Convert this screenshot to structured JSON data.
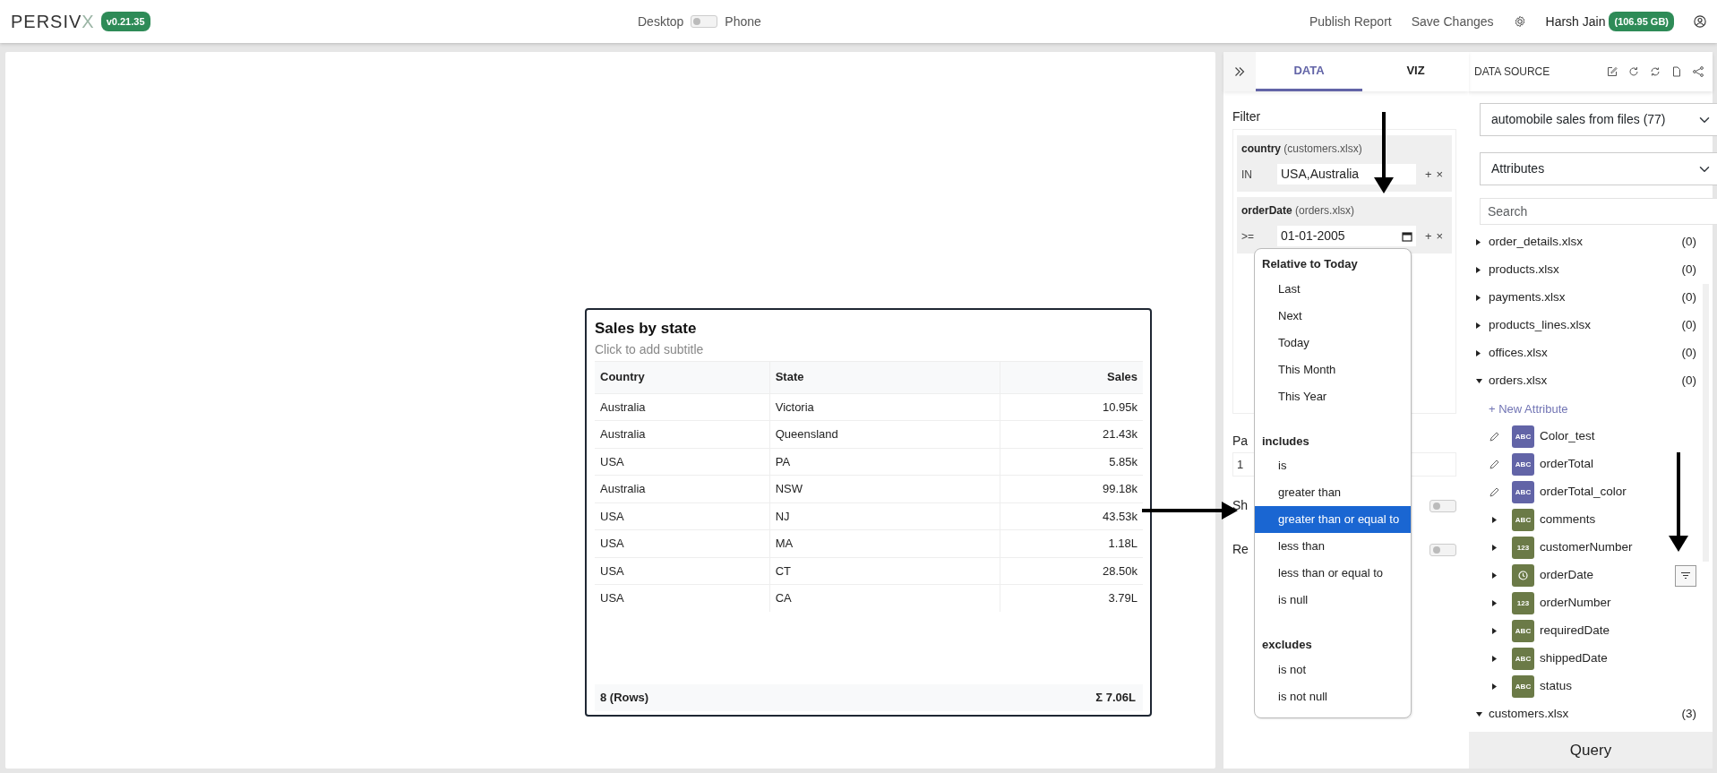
{
  "header": {
    "logo": "PERSIV",
    "logo_mark": "X",
    "version": "v0.21.35",
    "view_toggle": {
      "left": "Desktop",
      "right": "Phone",
      "on": false
    },
    "actions": [
      "Publish Report",
      "Save Changes"
    ],
    "user": "Harsh Jain",
    "storage": "(106.95 GB)"
  },
  "canvas": {
    "widget": {
      "title": "Sales by state",
      "subtitle": "Click to add subtitle",
      "columns": [
        {
          "label": "Country"
        },
        {
          "label": "State"
        },
        {
          "label": "Sales"
        }
      ],
      "rows": [
        [
          "Australia",
          "Victoria",
          "10.95k"
        ],
        [
          "Australia",
          "Queensland",
          "21.43k"
        ],
        [
          "USA",
          "PA",
          "5.85k"
        ],
        [
          "Australia",
          "NSW",
          "99.18k"
        ],
        [
          "USA",
          "NJ",
          "43.53k"
        ],
        [
          "USA",
          "MA",
          "1.18L"
        ],
        [
          "USA",
          "CT",
          "28.50k"
        ],
        [
          "USA",
          "CA",
          "3.79L"
        ]
      ],
      "footer": {
        "count": "8 (Rows)",
        "total": "Σ 7.06L"
      }
    }
  },
  "panel": {
    "tabs": [
      {
        "label": "DATA",
        "selected": true
      },
      {
        "label": "VIZ",
        "selected": false
      }
    ],
    "filter_label": "Filter",
    "filters": [
      {
        "field": "country",
        "source": "(customers.xlsx)",
        "operator": "IN",
        "value": "USA,Australia",
        "kind": "text",
        "add": "+",
        "remove": "×"
      },
      {
        "field": "orderDate",
        "source": "(orders.xlsx)",
        "operator": ">=",
        "value": "01-01-2005",
        "kind": "date",
        "add": "+",
        "remove": "×"
      }
    ],
    "operator_menu": {
      "groups": [
        {
          "heading": "Relative to Today",
          "items": [
            {
              "label": "Last",
              "selected": false
            },
            {
              "label": "Next",
              "selected": false
            },
            {
              "label": "Today",
              "selected": false
            },
            {
              "label": "This Month",
              "selected": false
            },
            {
              "label": "This Year",
              "selected": false
            }
          ]
        },
        {
          "heading": "includes",
          "items": [
            {
              "label": "is",
              "selected": false
            },
            {
              "label": "greater than",
              "selected": false
            },
            {
              "label": "greater than or equal to",
              "selected": true
            },
            {
              "label": "less than",
              "selected": false
            },
            {
              "label": "less than or equal to",
              "selected": false
            },
            {
              "label": "is null",
              "selected": false
            }
          ]
        },
        {
          "heading": "excludes",
          "items": [
            {
              "label": "is not",
              "selected": false
            },
            {
              "label": "is not null",
              "selected": false
            }
          ]
        }
      ]
    },
    "settings": [
      {
        "label": "Pa",
        "kind": "input",
        "value": "1"
      },
      {
        "label": "Sh",
        "kind": "toggle",
        "on": false
      },
      {
        "label": "Re",
        "kind": "toggle",
        "on": false
      }
    ]
  },
  "data_source": {
    "title": "DATA SOURCE",
    "source_select": "automobile sales from files (77)",
    "mode_select": "Attributes",
    "search": {
      "placeholder": "Search"
    },
    "tables": [
      {
        "name": "order_details.xlsx",
        "count": "(0)",
        "expanded": false
      },
      {
        "name": "products.xlsx",
        "count": "(0)",
        "expanded": false
      },
      {
        "name": "payments.xlsx",
        "count": "(0)",
        "expanded": false
      },
      {
        "name": "products_lines.xlsx",
        "count": "(0)",
        "expanded": false
      },
      {
        "name": "offices.xlsx",
        "count": "(0)",
        "expanded": false
      },
      {
        "name": "orders.xlsx",
        "count": "(0)",
        "expanded": true,
        "new_attribute": "+ New Attribute",
        "attributes": [
          {
            "name": "Color_test",
            "kind": "custom",
            "badge": "ABC",
            "color": "#6264a7",
            "hovered": false
          },
          {
            "name": "orderTotal",
            "kind": "custom",
            "badge": "ABC",
            "color": "#6264a7",
            "hovered": false
          },
          {
            "name": "orderTotal_color",
            "kind": "custom",
            "badge": "ABC",
            "color": "#6264a7",
            "hovered": false
          },
          {
            "name": "comments",
            "kind": "field",
            "badge": "ABC",
            "color": "#6b7a47",
            "hovered": false
          },
          {
            "name": "customerNumber",
            "kind": "field",
            "badge": "123",
            "color": "#6b7a47",
            "hovered": false
          },
          {
            "name": "orderDate",
            "kind": "field",
            "color": "#6b7a47",
            "hovered": true
          },
          {
            "name": "orderNumber",
            "kind": "field",
            "badge": "123",
            "color": "#6b7a47",
            "hovered": false
          },
          {
            "name": "requiredDate",
            "kind": "field",
            "badge": "ABC",
            "color": "#6b7a47",
            "hovered": false
          },
          {
            "name": "shippedDate",
            "kind": "field",
            "badge": "ABC",
            "color": "#6b7a47",
            "hovered": false
          },
          {
            "name": "status",
            "kind": "field",
            "badge": "ABC",
            "color": "#6b7a47",
            "hovered": false
          }
        ]
      },
      {
        "name": "customers.xlsx",
        "count": "(3)",
        "expanded": true
      }
    ],
    "query_button": "Query"
  }
}
